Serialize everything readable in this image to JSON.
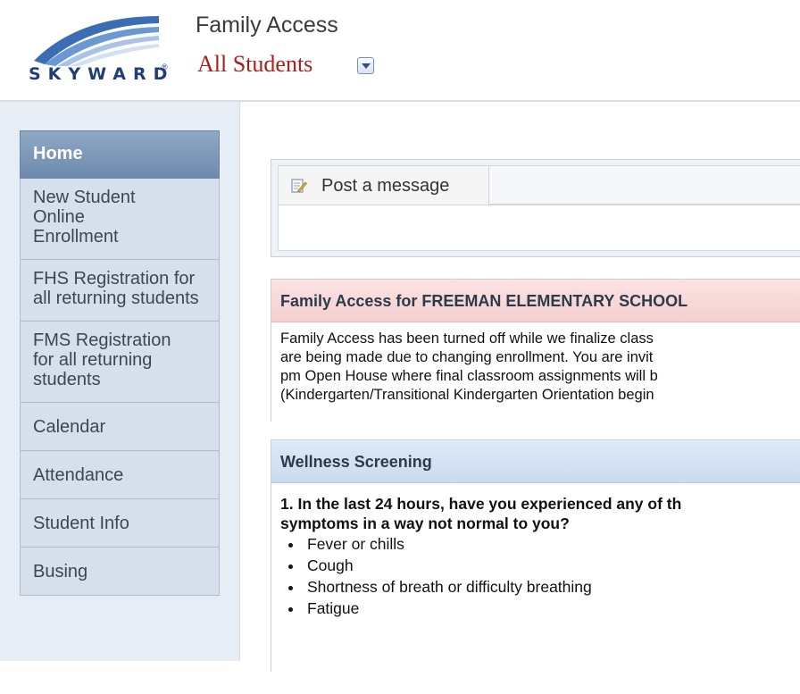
{
  "brand": {
    "logo_text": "SKYWARD",
    "logo_reg": "®"
  },
  "header": {
    "app_title": "Family Access",
    "student_selector": "All Students"
  },
  "sidebar": {
    "items": [
      {
        "label": "Home",
        "active": true
      },
      {
        "label": "New Student Online Enrollment"
      },
      {
        "label": "FHS Registration for all returning students"
      },
      {
        "label": "FMS Registration for all returning students"
      },
      {
        "label": "Calendar"
      },
      {
        "label": "Attendance"
      },
      {
        "label": "Student Info"
      },
      {
        "label": "Busing"
      }
    ]
  },
  "message_box": {
    "tab_label": "Post a message"
  },
  "announcement": {
    "title": "Family Access for FREEMAN ELEMENTARY SCHOOL",
    "lines": [
      "Family Access has been turned off while we finalize class",
      "are being made due to changing enrollment. You are invit",
      "pm Open House where final classroom assignments will b",
      "(Kindergarten/Transitional Kindergarten Orientation begin"
    ]
  },
  "wellness": {
    "title": "Wellness Screening",
    "question_line1": "1. In the last 24 hours, have you experienced any of th",
    "question_line2": "symptoms in a way not normal to you?",
    "symptoms": [
      "Fever or chills",
      "Cough",
      "Shortness of breath or difficulty breathing",
      "Fatigue"
    ]
  },
  "colors": {
    "accent": "#6d8aae",
    "brand_red": "#a8201a",
    "brand_blue": "#1f3f7a"
  }
}
